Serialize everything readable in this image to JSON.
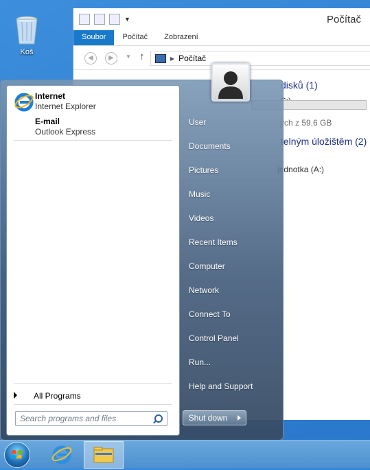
{
  "desktop": {
    "recycle_bin_label": "Koš"
  },
  "explorer": {
    "title": "Počítač",
    "ribbon_tabs": [
      "Soubor",
      "Počítač",
      "Zobrazení"
    ],
    "address": "Počítač",
    "group_drives": "disků (1)",
    "drive_letter_partial": "C:)",
    "drive_free_partial": "ých z 59,6 GB",
    "group_removable": "telným úložištěm (2)",
    "floppy_partial": "jednotka (A:)"
  },
  "startmenu": {
    "pinned": [
      {
        "title": "Internet",
        "subtitle": "Internet Explorer",
        "icon": "internet-explorer-icon"
      },
      {
        "title": "E-mail",
        "subtitle": "Outlook Express",
        "icon": "outlook-express-icon"
      }
    ],
    "all_programs": "All Programs",
    "search_placeholder": "Search programs and files",
    "right_items": [
      "User",
      "Documents",
      "Pictures",
      "Music",
      "Videos",
      "Recent Items",
      "Computer",
      "Network",
      "Connect To",
      "Control Panel",
      "Run...",
      "Help and Support"
    ],
    "shutdown_label": "Shut down"
  },
  "taskbar": {
    "items": [
      "start-orb",
      "internet-explorer",
      "file-explorer"
    ]
  }
}
